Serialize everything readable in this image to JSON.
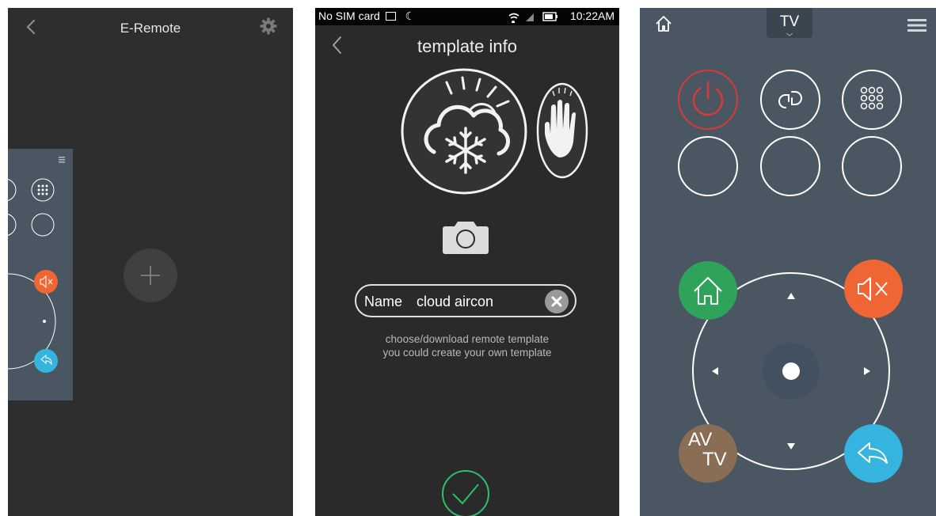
{
  "screen1": {
    "title": "E-Remote",
    "icons": [
      "back-icon",
      "gear-icon",
      "plus-icon"
    ]
  },
  "screen2": {
    "status_bar": {
      "carrier": "No SIM card",
      "time": "10:22AM"
    },
    "title": "template info",
    "name_label": "Name",
    "name_value": "cloud aircon",
    "help_line1": "choose/download remote template",
    "help_line2": "you could create your own template"
  },
  "screen3": {
    "device_tab": "TV",
    "av_label": "AV",
    "tv_label": "TV"
  },
  "colors": {
    "power": "#d63a3a",
    "home": "#2fa35a",
    "mute": "#ef6634",
    "source": "#8a6d55",
    "return": "#34b4df",
    "confirm": "#2fbf6a"
  }
}
